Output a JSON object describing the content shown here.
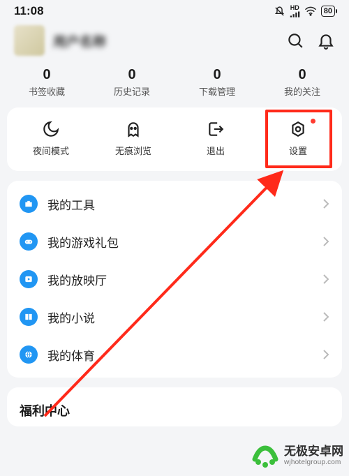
{
  "status": {
    "time": "11:08",
    "signal_text": "HD",
    "battery": "80"
  },
  "profile": {
    "username": "用户名称"
  },
  "stats": [
    {
      "value": "0",
      "label": "书签收藏"
    },
    {
      "value": "0",
      "label": "历史记录"
    },
    {
      "value": "0",
      "label": "下载管理"
    },
    {
      "value": "0",
      "label": "我的关注"
    }
  ],
  "quick": [
    {
      "label": "夜间模式",
      "icon": "moon-icon"
    },
    {
      "label": "无痕浏览",
      "icon": "ghost-icon"
    },
    {
      "label": "退出",
      "icon": "exit-icon"
    },
    {
      "label": "设置",
      "icon": "settings-icon",
      "has_dot": true
    }
  ],
  "list": [
    {
      "label": "我的工具",
      "icon": "briefcase-icon",
      "color": "#2196f3"
    },
    {
      "label": "我的游戏礼包",
      "icon": "gamepad-icon",
      "color": "#2196f3"
    },
    {
      "label": "我的放映厅",
      "icon": "play-icon",
      "color": "#2196f3"
    },
    {
      "label": "我的小说",
      "icon": "book-icon",
      "color": "#2196f3"
    },
    {
      "label": "我的体育",
      "icon": "sports-icon",
      "color": "#2196f3"
    }
  ],
  "section_header": "福利中心",
  "watermark": {
    "title": "无极安卓网",
    "sub": "wjhotelgroup.com"
  },
  "highlight_index": 3
}
